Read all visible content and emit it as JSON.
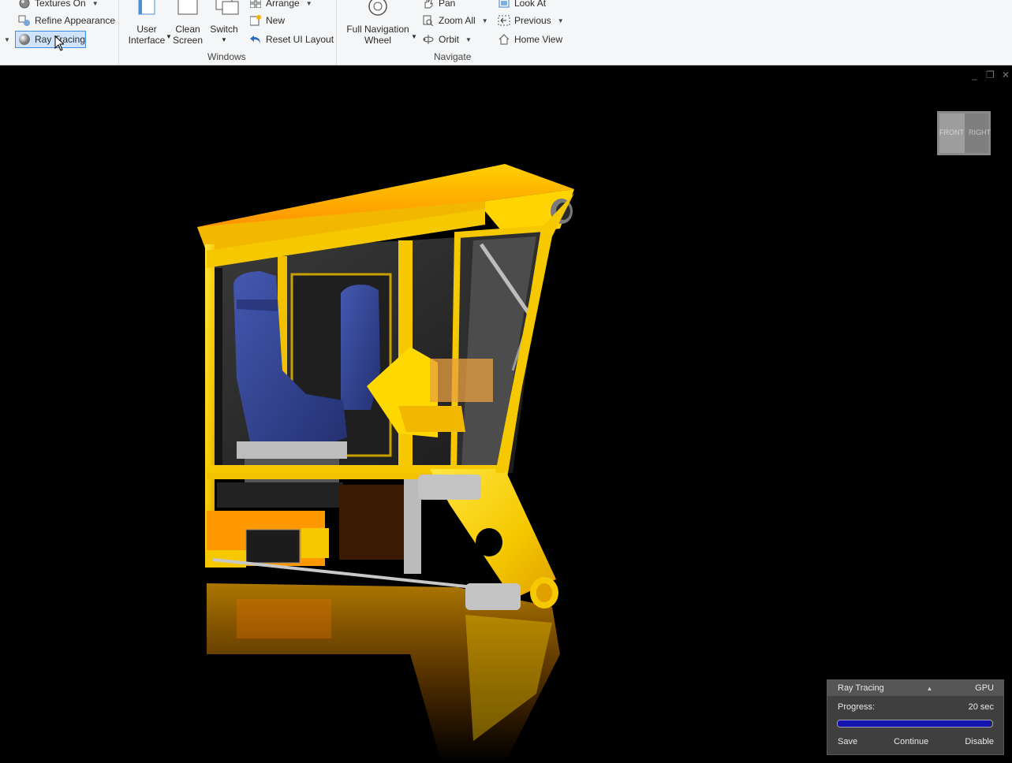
{
  "ribbon": {
    "appearance": {
      "textures_label": "Textures On",
      "refine_label": "Refine Appearance",
      "raytracing_label": "Ray Tracing"
    },
    "windows": {
      "user_interface_label_1": "User",
      "user_interface_label_2": "Interface",
      "clean_screen_label_1": "Clean",
      "clean_screen_label_2": "Screen",
      "switch_label": "Switch",
      "arrange_label": "Arrange",
      "new_label": "New",
      "reset_label": "Reset UI Layout",
      "group_label": "Windows"
    },
    "navigate": {
      "full_nav_label_1": "Full Navigation",
      "full_nav_label_2": "Wheel",
      "pan_label": "Pan",
      "zoom_all_label": "Zoom All",
      "orbit_label": "Orbit",
      "look_at_label": "Look At",
      "previous_label": "Previous",
      "home_view_label": "Home View",
      "group_label": "Navigate"
    }
  },
  "viewcube": {
    "front_label": "FRONT",
    "right_label": "RIGHT"
  },
  "raytracing_panel": {
    "title": "Ray Tracing",
    "mode": "GPU",
    "progress_label": "Progress:",
    "time": "20 sec",
    "progress_fraction": 0.99,
    "save_label": "Save",
    "continue_label": "Continue",
    "disable_label": "Disable"
  },
  "colors": {
    "accent": "#3d8ee0",
    "model_yellow": "#f5d800",
    "seat_blue": "#2e3f8f",
    "progress_fill": "#1414b0"
  }
}
